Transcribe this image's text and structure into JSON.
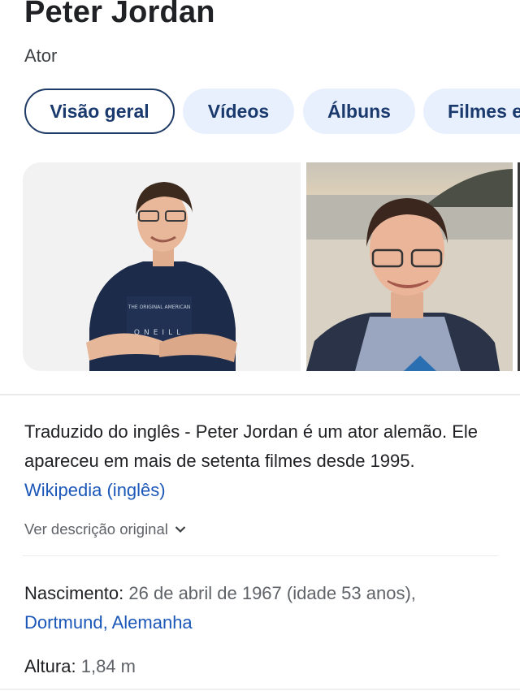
{
  "header": {
    "title": "Peter Jordan",
    "subtitle": "Ator"
  },
  "tabs": [
    {
      "label": "Visão geral",
      "active": true
    },
    {
      "label": "Vídeos",
      "active": false
    },
    {
      "label": "Álbuns",
      "active": false
    },
    {
      "label": "Filmes e",
      "active": false
    }
  ],
  "description": {
    "text": "Traduzido do inglês - Peter Jordan é um ator alemão. Ele apareceu em mais de setenta filmes desde 1995.",
    "source_link": "Wikipedia (inglês)",
    "more_label": "Ver descrição original"
  },
  "facts": {
    "birth": {
      "label": "Nascimento:",
      "value": "26 de abril de 1967 (idade 53 anos),",
      "place": "Dortmund, Alemanha"
    },
    "height": {
      "label": "Altura:",
      "value": "1,84 m"
    }
  },
  "colors": {
    "link": "#1a57b8",
    "chip_bg": "#e8f0fe",
    "chip_border": "#1f3b66",
    "chip_text": "#1a3a6e"
  },
  "icons": {
    "more": "chevron-down-icon"
  }
}
